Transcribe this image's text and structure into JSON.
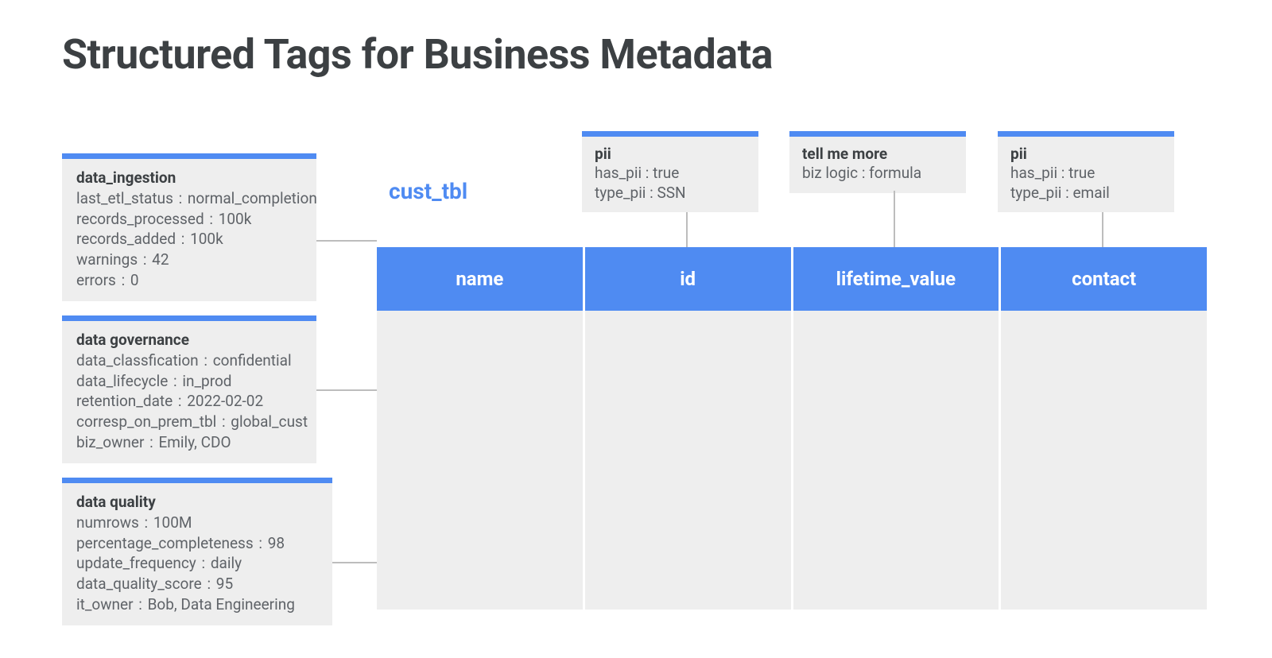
{
  "title": "Structured Tags for Business Metadata",
  "table_label": "cust_tbl",
  "side_tags": [
    {
      "title": "data_ingestion",
      "rows": [
        {
          "k": "last_etl_status",
          "v": "normal_completion"
        },
        {
          "k": "records_processed",
          "v": "100k"
        },
        {
          "k": "records_added",
          "v": "100k"
        },
        {
          "k": "warnings",
          "v": "42"
        },
        {
          "k": "errors",
          "v": "0"
        }
      ]
    },
    {
      "title": "data governance",
      "rows": [
        {
          "k": "data_classfication",
          "v": "confidential"
        },
        {
          "k": "data_lifecycle",
          "v": "in_prod"
        },
        {
          "k": "retention_date",
          "v": "2022-02-02"
        },
        {
          "k": "corresp_on_prem_tbl",
          "v": "global_cust"
        },
        {
          "k": "biz_owner",
          "v": "Emily, CDO"
        }
      ]
    },
    {
      "title": "data quality",
      "rows": [
        {
          "k": "numrows",
          "v": "100M"
        },
        {
          "k": "percentage_completeness",
          "v": "98"
        },
        {
          "k": "update_frequency",
          "v": "daily"
        },
        {
          "k": "data_quality_score",
          "v": "95"
        },
        {
          "k": "it_owner",
          "v": "Bob, Data Engineering"
        }
      ]
    }
  ],
  "col_tags": [
    {
      "title": "pii",
      "rows": [
        {
          "k": "has_pii",
          "v": "true"
        },
        {
          "k": "type_pii",
          "v": "SSN"
        }
      ]
    },
    {
      "title": "tell me more",
      "rows": [
        {
          "k": "biz logic",
          "v": "formula"
        }
      ]
    },
    {
      "title": "pii",
      "rows": [
        {
          "k": "has_pii",
          "v": "true"
        },
        {
          "k": "type_pii",
          "v": "email"
        }
      ]
    }
  ],
  "columns": [
    "name",
    "id",
    "lifetime_value",
    "contact"
  ]
}
